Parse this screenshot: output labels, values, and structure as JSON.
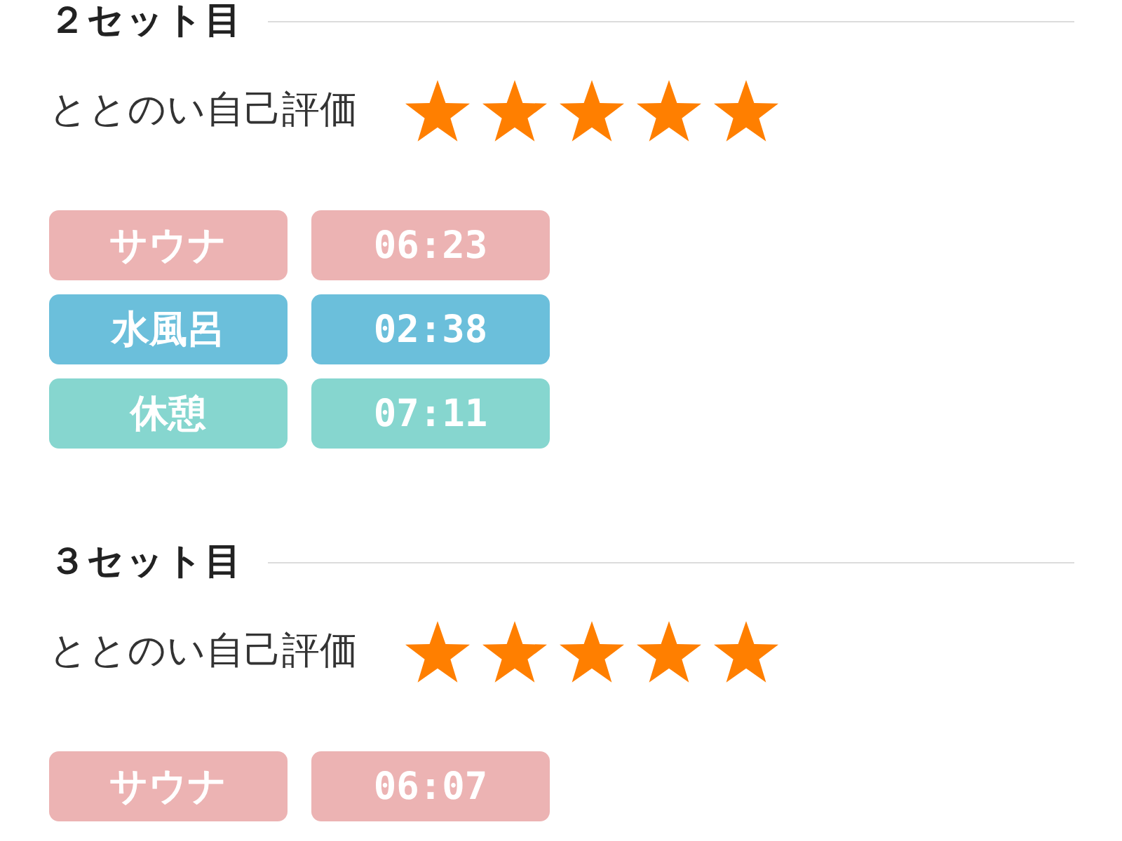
{
  "sets": [
    {
      "title": "２セット目",
      "rating": {
        "label": "ととのい自己評価",
        "stars": 5
      },
      "phases": [
        {
          "name": "サウナ",
          "time": "06:23",
          "color": "#ecb3b3"
        },
        {
          "name": "水風呂",
          "time": "02:38",
          "color": "#6bbfdb"
        },
        {
          "name": "休憩",
          "time": "07:11",
          "color": "#86d6cf"
        }
      ]
    },
    {
      "title": "３セット目",
      "rating": {
        "label": "ととのい自己評価",
        "stars": 5
      },
      "phases": [
        {
          "name": "サウナ",
          "time": "06:07",
          "color": "#ecb3b3"
        }
      ]
    }
  ]
}
